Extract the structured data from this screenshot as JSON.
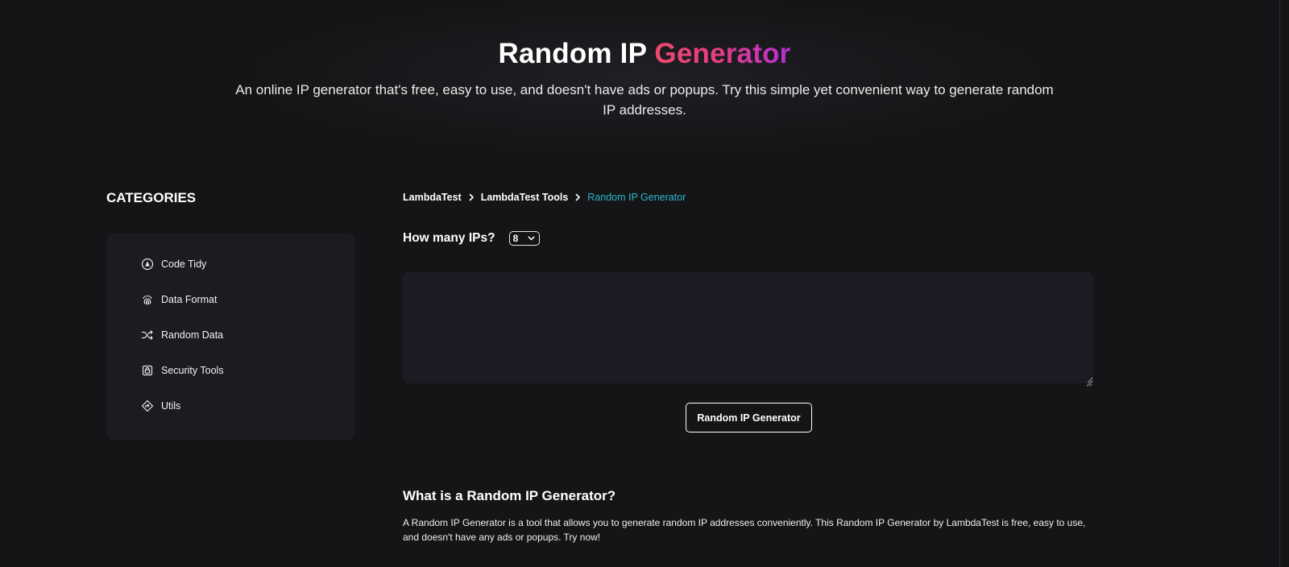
{
  "hero": {
    "title_main": "Random IP ",
    "title_accent": "Generator",
    "subtitle": "An online IP generator that's free, easy to use, and doesn't have ads or popups. Try this simple yet convenient way to generate random IP addresses."
  },
  "sidebar": {
    "heading": "CATEGORIES",
    "items": [
      {
        "label": "Code Tidy",
        "icon": "code-tidy-icon"
      },
      {
        "label": "Data Format",
        "icon": "fingerprint-icon"
      },
      {
        "label": "Random Data",
        "icon": "shuffle-icon"
      },
      {
        "label": "Security Tools",
        "icon": "lock-icon"
      },
      {
        "label": "Utils",
        "icon": "diamond-icon"
      }
    ]
  },
  "breadcrumb": {
    "items": [
      "LambdaTest",
      "LambdaTest Tools"
    ],
    "current": "Random IP Generator"
  },
  "form": {
    "count_label": "How many IPs?",
    "count_value": "8",
    "output_value": "",
    "button_label": "Random IP Generator"
  },
  "about": {
    "heading": "What is a Random IP Generator?",
    "text": "A Random IP Generator is a tool that allows you to generate random IP addresses conveniently. This Random IP Generator by LambdaTest is free, easy to use, and doesn't have any ads or popups. Try now!"
  },
  "colors": {
    "background": "#151517",
    "panel": "#1b1b22",
    "accent_link": "#2bb6c9",
    "gradient_start": "#f04a6a",
    "gradient_end": "#b62fd6"
  }
}
